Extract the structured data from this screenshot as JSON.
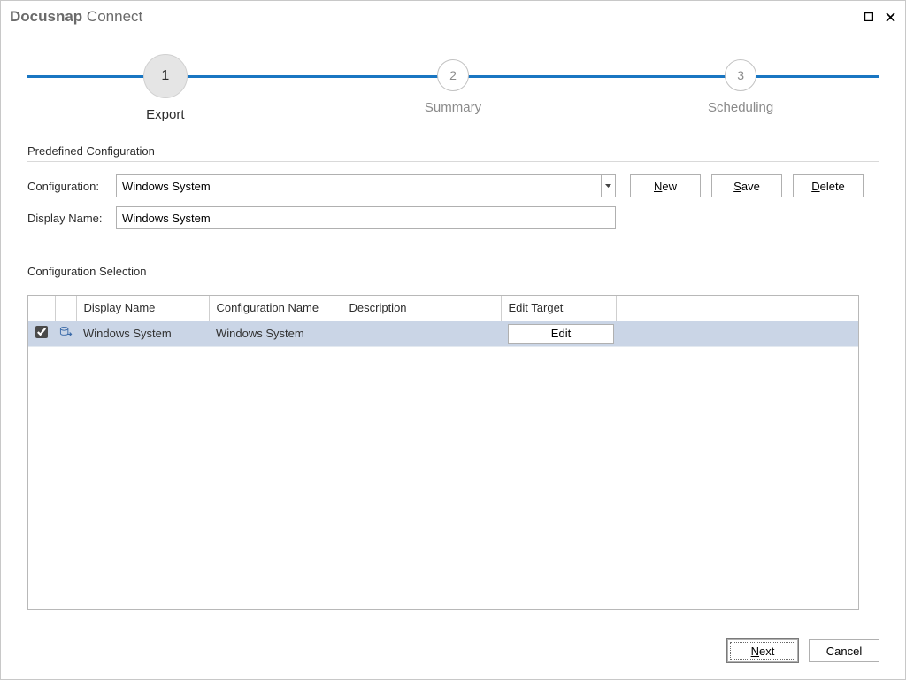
{
  "window": {
    "title_bold": "Docusnap",
    "title_light": "Connect"
  },
  "stepper": {
    "steps": [
      {
        "num": "1",
        "label": "Export",
        "active": true
      },
      {
        "num": "2",
        "label": "Summary",
        "active": false
      },
      {
        "num": "3",
        "label": "Scheduling",
        "active": false
      }
    ]
  },
  "predefined": {
    "section_title": "Predefined Configuration",
    "label_configuration": "Configuration:",
    "label_display_name": "Display Name:",
    "configuration_value": "Windows System",
    "display_name_value": "Windows System",
    "buttons": {
      "new": "New",
      "save": "Save",
      "delete": "Delete"
    },
    "accel": {
      "new": "N",
      "save": "S",
      "delete": "D"
    }
  },
  "selection": {
    "section_title": "Configuration Selection",
    "columns": {
      "display_name": "Display Name",
      "configuration_name": "Configuration Name",
      "description": "Description",
      "edit_target": "Edit Target"
    },
    "rows": [
      {
        "checked": true,
        "display_name": "Windows System",
        "configuration_name": "Windows System",
        "description": "",
        "edit_button": "Edit"
      }
    ]
  },
  "footer": {
    "next": "Next",
    "cancel": "Cancel",
    "accel_next": "N"
  }
}
